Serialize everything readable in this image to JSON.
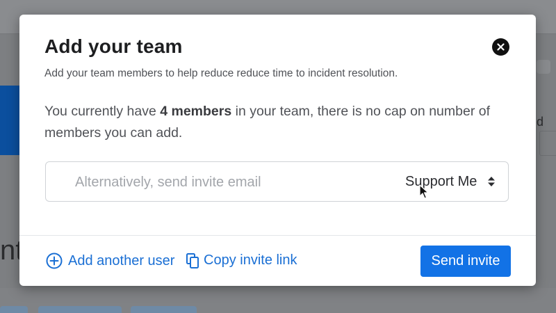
{
  "modal": {
    "title": "Add your team",
    "subtitle": "Add your team members to help reduce reduce time to incident resolution.",
    "info": {
      "prefix": "You currently have ",
      "highlight": "4 members",
      "suffix": " in your team, there is no cap on number of members you can add."
    },
    "email_placeholder": "Alternatively, send invite email",
    "email_value": "",
    "role_selected": "Support Me",
    "add_user_label": "Add another user",
    "copy_link_label": "Copy invite link",
    "send_label": "Send invite"
  },
  "background": {
    "heading_fragment": "nt",
    "right_fragment": "d"
  },
  "colors": {
    "accent": "#1272e6",
    "link": "#1a6fd4",
    "close_bg": "#111111",
    "overlay": "#7d7f82"
  },
  "icons": [
    "close-icon",
    "sort-arrows-icon",
    "plus-circle-icon",
    "copy-icon",
    "cursor-icon"
  ]
}
